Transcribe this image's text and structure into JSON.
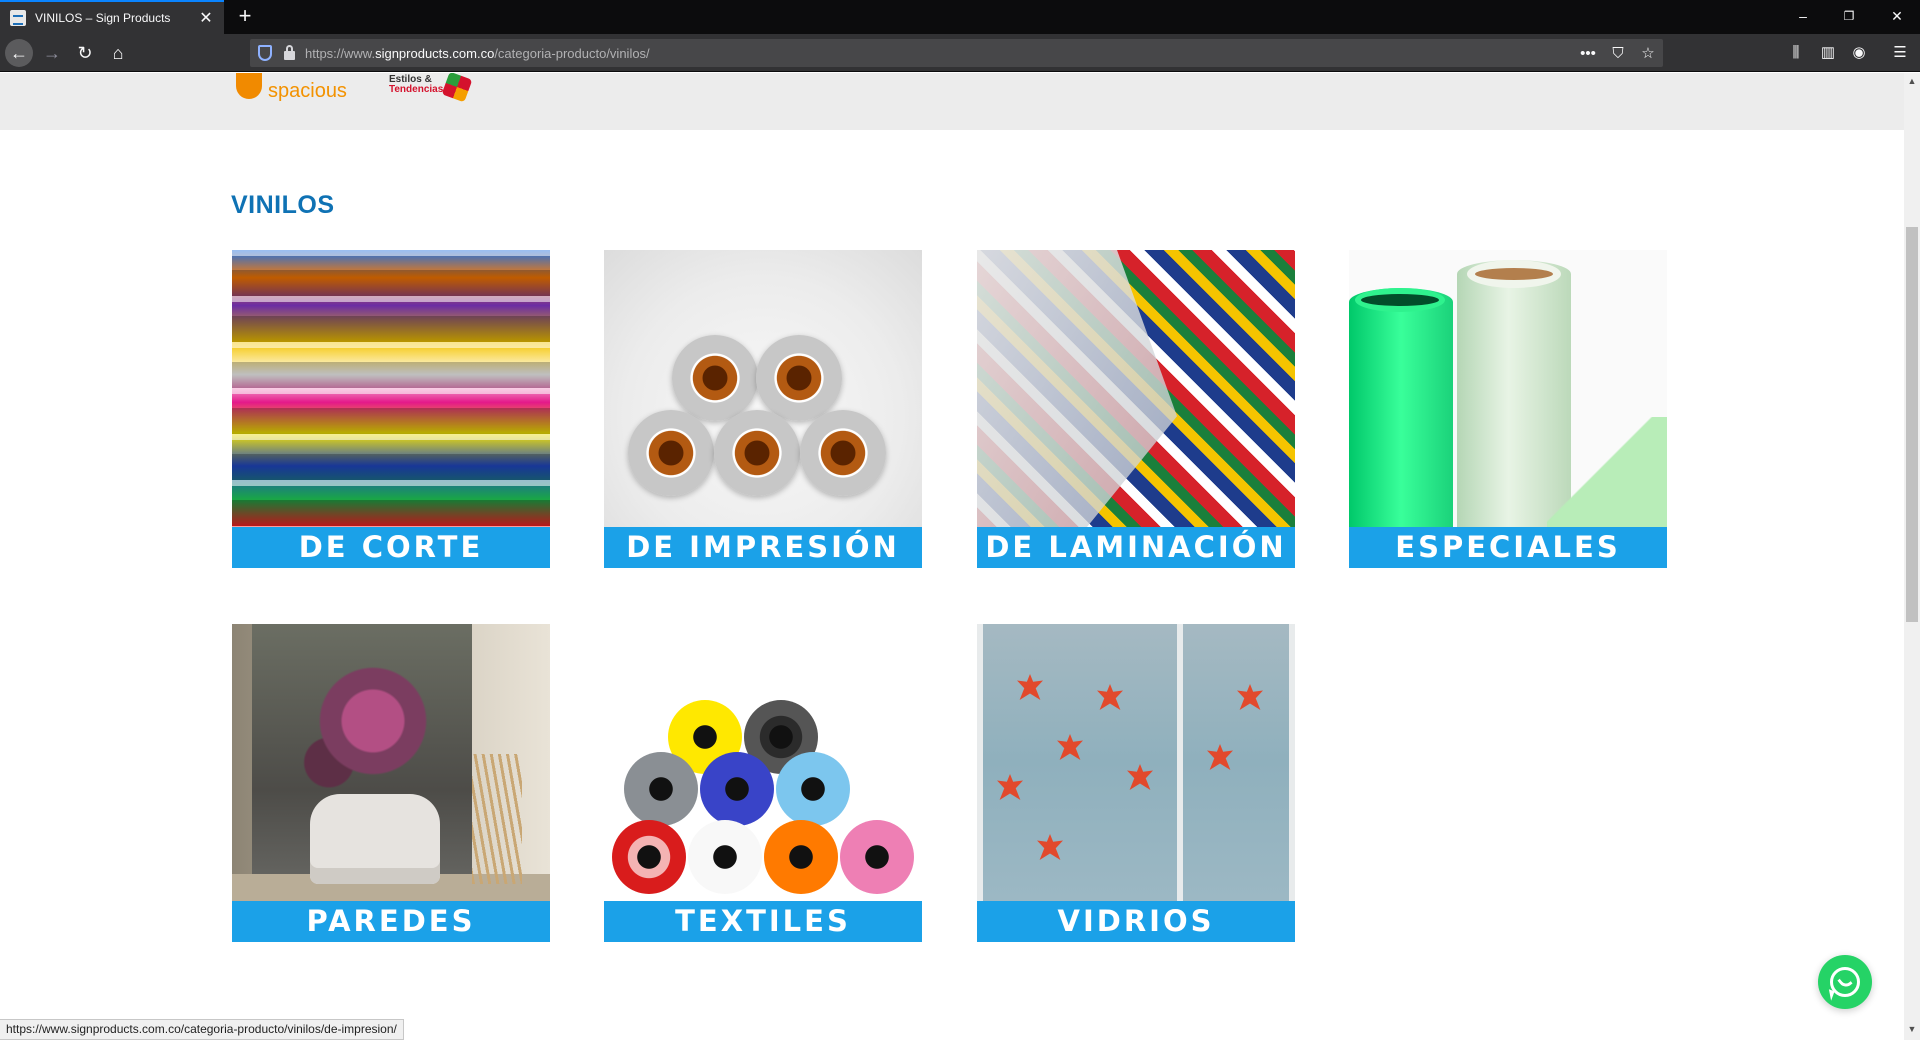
{
  "browser": {
    "tab_title": "VINILOS – Sign Products",
    "tab_close": "✕",
    "new_tab": "+",
    "url_prefix": "https://www.",
    "url_host": "signproducts.com.co",
    "url_path": "/categoria-producto/vinilos/",
    "window_controls": {
      "minimize": "–",
      "restore": "❐",
      "close": "✕"
    },
    "status_url": "https://www.signproducts.com.co/categoria-producto/vinilos/de-impresion/"
  },
  "header": {
    "logo_spacious": "spacious",
    "logo_estilos_line1": "Estilos &",
    "logo_estilos_line2": "Tendencias"
  },
  "page": {
    "section_title": "VINILOS",
    "categories": [
      {
        "label": "DE CORTE"
      },
      {
        "label": "DE IMPRESIÓN"
      },
      {
        "label": "DE LAMINACIÓN"
      },
      {
        "label": "ESPECIALES"
      },
      {
        "label": "PAREDES"
      },
      {
        "label": "TEXTILES"
      },
      {
        "label": "VIDRIOS"
      }
    ]
  },
  "colors": {
    "accent": "#1ba1e8",
    "title": "#0f72b4",
    "whatsapp": "#25d366"
  }
}
